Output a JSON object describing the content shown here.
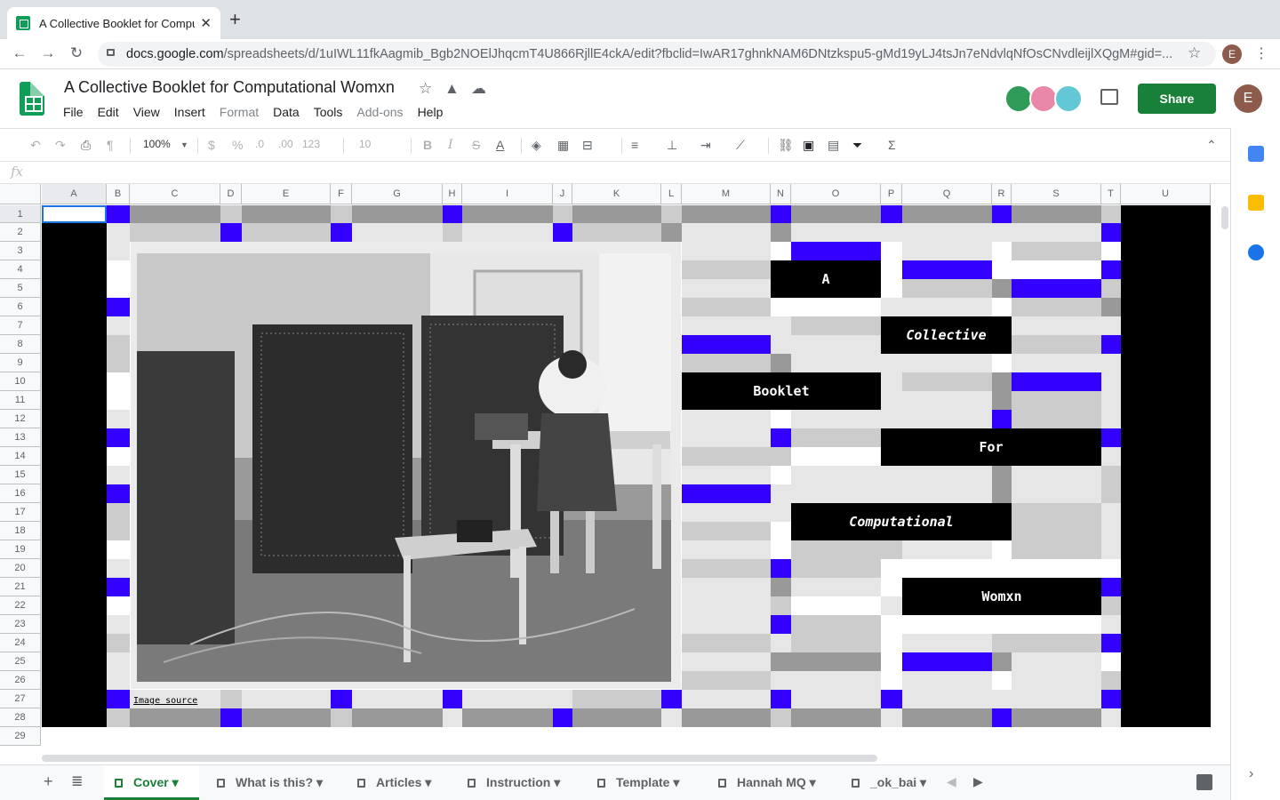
{
  "browser": {
    "tab_title": "A Collective Booklet for Computational Womxn",
    "url_domain": "docs.google.com",
    "url_path": "/spreadsheets/d/1uIWL11fkAagmib_Bgb2NOElJhqcmT4U866RjllE4ckA/edit?fbclid=IwAR17ghnkNAM6DNtzkspu5-gMd19yLJ4tsJn7eNdvlqNfOsCNvdleijlXQgM#gid=...",
    "profile_initial": "E"
  },
  "doc": {
    "title": "A Collective Booklet for Computational Womxn",
    "menu": [
      "File",
      "Edit",
      "View",
      "Insert",
      "Format",
      "Data",
      "Tools",
      "Add-ons",
      "Help"
    ],
    "share_label": "Share",
    "profile_initial": "E"
  },
  "toolbar": {
    "zoom": "100%",
    "currency": "$",
    "percent": "%",
    "dec_less": ".0",
    "dec_more": ".00",
    "format": "123",
    "font_size": "10"
  },
  "formula_bar": {
    "fx": "fx",
    "value": ""
  },
  "columns": [
    "A",
    "B",
    "C",
    "D",
    "E",
    "F",
    "G",
    "H",
    "I",
    "J",
    "K",
    "L",
    "M",
    "N",
    "O",
    "P",
    "Q",
    "R",
    "S",
    "T",
    "U"
  ],
  "rows": [
    "1",
    "2",
    "3",
    "4",
    "5",
    "6",
    "7",
    "8",
    "9",
    "10",
    "11",
    "12",
    "13",
    "14",
    "15",
    "16",
    "17",
    "18",
    "19",
    "20",
    "21",
    "22",
    "23",
    "24",
    "25",
    "26",
    "27",
    "28",
    "29"
  ],
  "cover": {
    "words": [
      "A",
      "Collective",
      "Booklet",
      "For",
      "Computational",
      "Womxn"
    ],
    "image_link": "Image source"
  },
  "sheets": [
    "Cover",
    "What is this?",
    "Articles",
    "Instruction",
    "Template",
    "Hannah MQ",
    "_ok_bai"
  ],
  "active_sheet": "Cover",
  "colors": {
    "accent": "#3300ff",
    "dark_gray": "#999999",
    "light_gray": "#cccccc",
    "pale_gray": "#e6e6e6",
    "share_green": "#188038"
  }
}
